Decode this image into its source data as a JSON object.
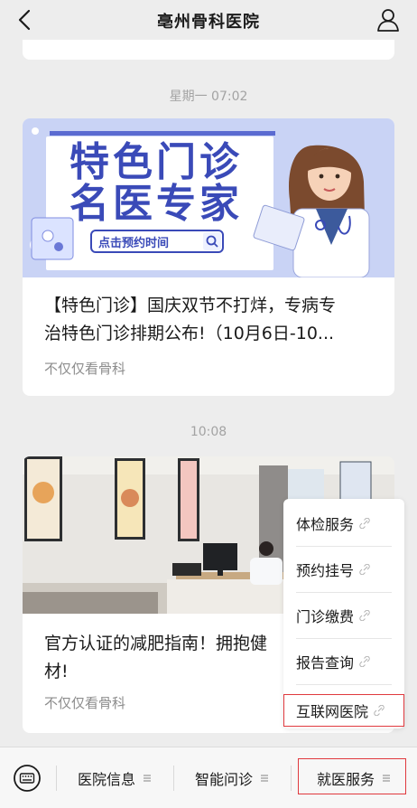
{
  "header": {
    "title": "亳州骨科医院"
  },
  "feed": [
    {
      "time": "星期一 07:02",
      "banner": {
        "line1": "特色门诊",
        "line2": "名医专家",
        "button": "点击预约时间"
      },
      "headline_line1": "【特色门诊】国庆双节不打烊，专病专",
      "headline_line2": "治特色门诊排期公布!（10月6日-10...",
      "source": "不仅仅看骨科"
    },
    {
      "time": "10:08",
      "headline_line1": "官方认证的减肥指南！拥抱健",
      "headline_line2": "材!",
      "source": "不仅仅看骨科"
    }
  ],
  "popup_menu": {
    "items": [
      "体检服务",
      "预约挂号",
      "门诊缴费",
      "报告查询",
      "互联网医院"
    ],
    "highlighted": "互联网医院"
  },
  "bottom_menu": {
    "tabs": [
      "医院信息",
      "智能问诊",
      "就医服务"
    ],
    "active": "就医服务"
  },
  "colors": {
    "highlight_border": "#e0393e",
    "banner_bg": "#c9d3f5",
    "banner_text": "#3a4ab8"
  },
  "icons": [
    "back-arrow-icon",
    "user-profile-icon",
    "link-icon",
    "keyboard-icon",
    "menu-lines-icon",
    "search-icon"
  ]
}
